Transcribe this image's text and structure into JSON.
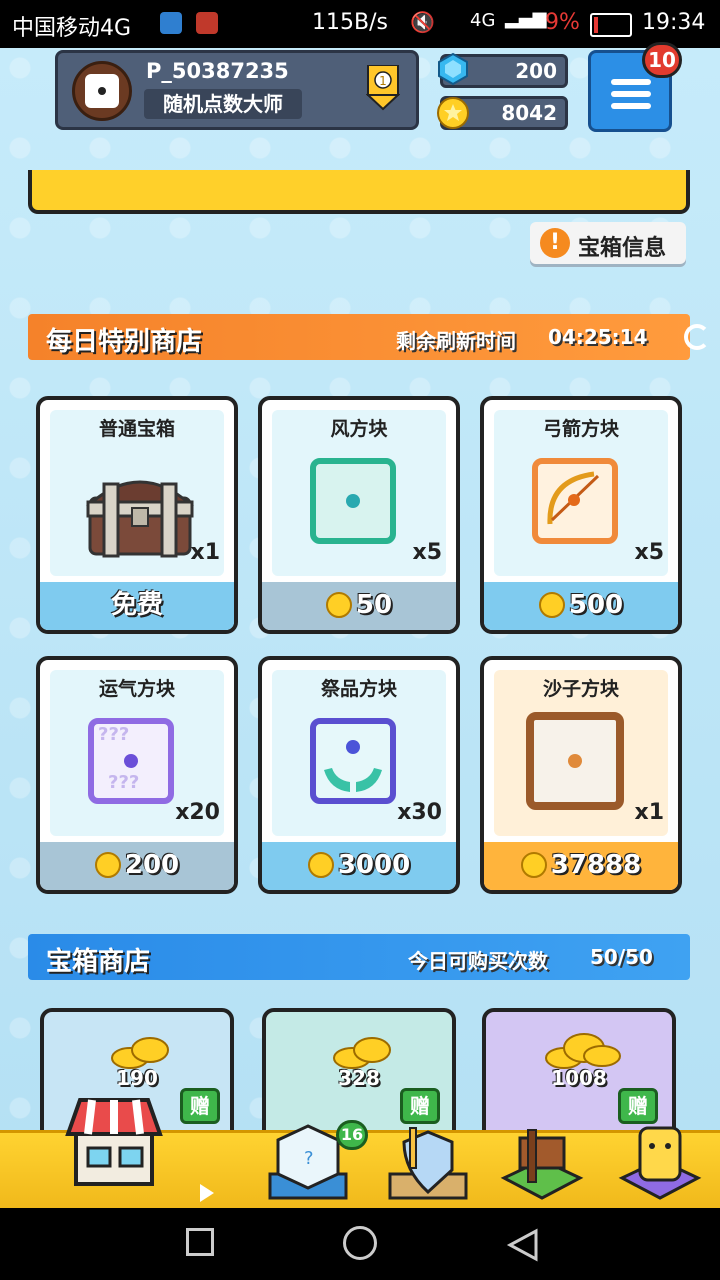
{
  "status_bar": {
    "carrier": "中国移动4G",
    "net_speed": "115B/s",
    "signal": "4G",
    "battery": "9%",
    "time": "19:34"
  },
  "profile": {
    "player_id": "P_50387235",
    "title": "随机点数大师",
    "medal_icon": "rank-medal-icon"
  },
  "resources": {
    "gems": "200",
    "coins": "8042"
  },
  "menu": {
    "notification_count": "10"
  },
  "chest_info_button": {
    "label": "宝箱信息"
  },
  "daily_shop": {
    "title": "每日特别商店",
    "refresh_label": "剩余刷新时间",
    "refresh_time": "04:25:14",
    "items": [
      {
        "name": "普通宝箱",
        "qty": "x1",
        "price": "免费"
      },
      {
        "name": "风方块",
        "qty": "x5",
        "price": "50"
      },
      {
        "name": "弓箭方块",
        "qty": "x5",
        "price": "500"
      },
      {
        "name": "运气方块",
        "qty": "x20",
        "price": "200"
      },
      {
        "name": "祭品方块",
        "qty": "x30",
        "price": "3000"
      },
      {
        "name": "沙子方块",
        "qty": "x1",
        "price": "37888"
      }
    ]
  },
  "chest_shop": {
    "title": "宝箱商店",
    "limit_label": "今日可购买次数",
    "limit_value": "50/50",
    "items": [
      {
        "amount": "190",
        "gift": "赠"
      },
      {
        "amount": "328",
        "gift": "赠"
      },
      {
        "amount": "1008",
        "gift": "赠"
      }
    ]
  },
  "bottom_nav": {
    "badge": "16"
  },
  "colors": {
    "accent_orange": "#f5822a",
    "accent_blue": "#2a8be8",
    "coin_gold": "#ffcf25",
    "background": "#bfe6f6"
  }
}
